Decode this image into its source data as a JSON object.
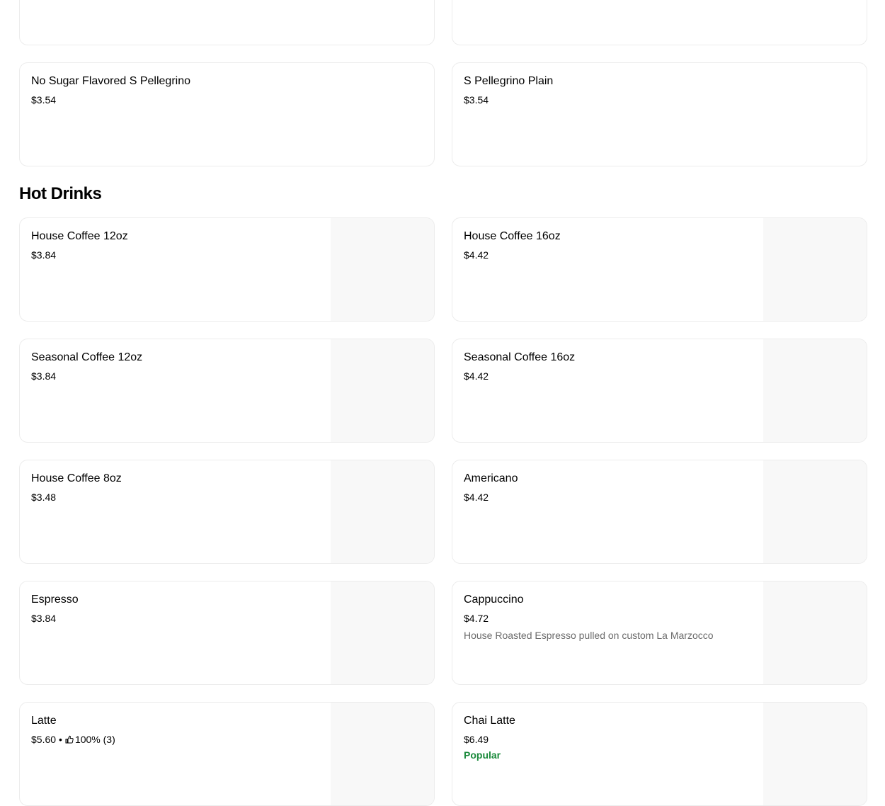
{
  "section_title": "Hot Drinks",
  "top_items": [
    {
      "name": "No Sugar Flavored S Pellegrino",
      "price": "$3.54"
    },
    {
      "name": "S Pellegrino Plain",
      "price": "$3.54"
    }
  ],
  "hot_drinks": [
    {
      "name": "House Coffee 12oz",
      "price": "$3.84"
    },
    {
      "name": "House Coffee 16oz",
      "price": "$4.42"
    },
    {
      "name": "Seasonal Coffee 12oz",
      "price": "$3.84"
    },
    {
      "name": "Seasonal Coffee 16oz",
      "price": "$4.42"
    },
    {
      "name": "House Coffee 8oz",
      "price": "$3.48"
    },
    {
      "name": "Americano",
      "price": "$4.42"
    },
    {
      "name": "Espresso",
      "price": "$3.84"
    },
    {
      "name": "Cappuccino",
      "price": "$4.72",
      "description": "House Roasted Espresso pulled on custom La Marzocco"
    },
    {
      "name": "Latte",
      "price": "$5.60",
      "separator": "•",
      "rating": "100% (3)",
      "rating_icon": "thumbs-up-icon"
    },
    {
      "name": "Chai Latte",
      "price": "$6.49",
      "badge": "Popular",
      "badge_color": "#1a8a3b"
    }
  ]
}
